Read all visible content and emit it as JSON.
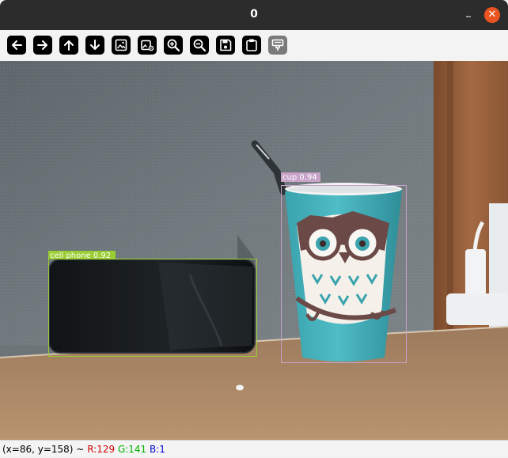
{
  "window": {
    "title": "0",
    "minimize_glyph": "–",
    "close_glyph": "✕"
  },
  "toolbar": {
    "buttons": [
      {
        "icon": "arrow-left-icon"
      },
      {
        "icon": "arrow-right-icon"
      },
      {
        "icon": "arrow-up-icon"
      },
      {
        "icon": "arrow-down-icon"
      },
      {
        "icon": "image-icon"
      },
      {
        "icon": "image-settings-icon"
      },
      {
        "icon": "zoom-in-icon"
      },
      {
        "icon": "zoom-out-icon"
      },
      {
        "icon": "save-icon"
      },
      {
        "icon": "clipboard-icon"
      },
      {
        "icon": "properties-icon",
        "disabled": true
      }
    ]
  },
  "detections": [
    {
      "label": "cell phone 0.92",
      "color": "#9acd32"
    },
    {
      "label": "cup 0.94",
      "color": "#c8a2c8"
    }
  ],
  "status": {
    "coords": "(x=86, y=158) ~",
    "r": "R:129",
    "g": "G:141",
    "b": "B:1"
  }
}
